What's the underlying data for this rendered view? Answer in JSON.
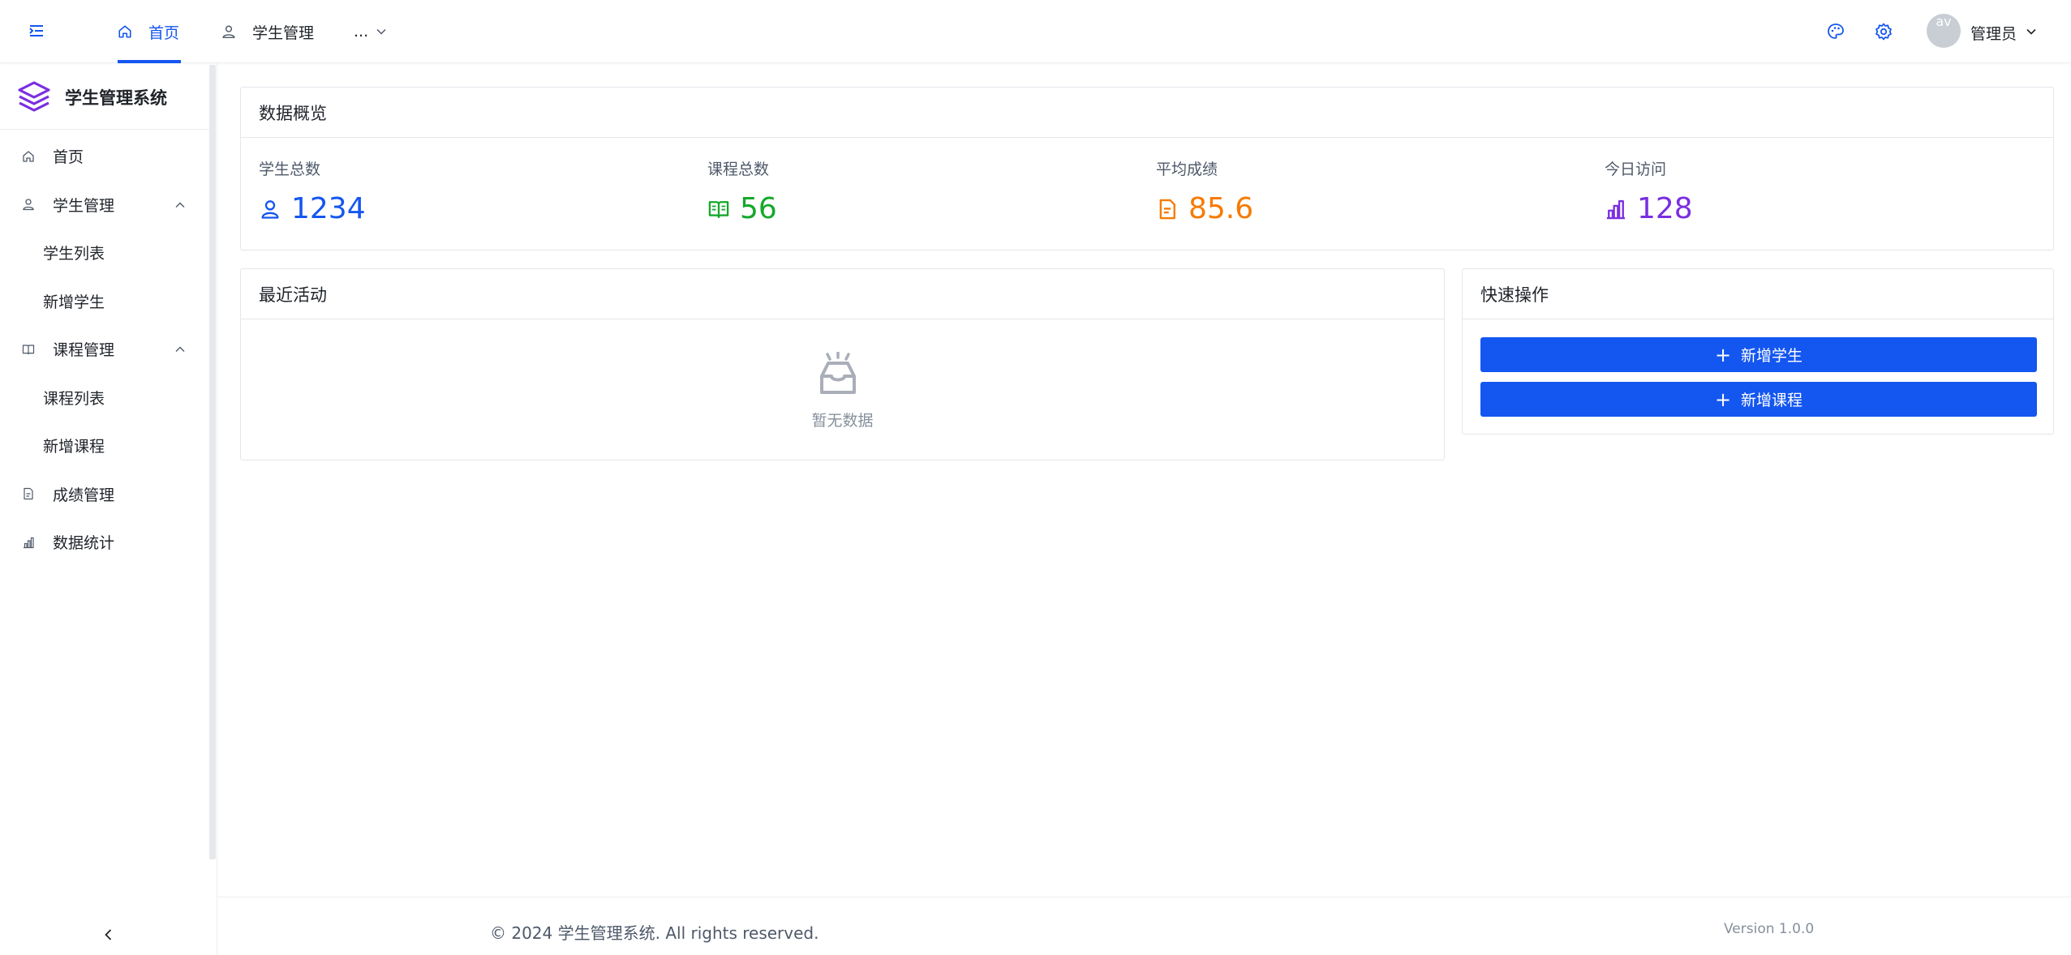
{
  "header": {
    "tabs": [
      {
        "label": "首页",
        "icon": "home-icon",
        "active": true
      },
      {
        "label": "学生管理",
        "icon": "user-icon",
        "active": false
      },
      {
        "label": "...",
        "icon": "chevron-down-icon",
        "active": false
      }
    ],
    "user_name": "管理员",
    "avatar_alt": "av"
  },
  "sidebar": {
    "app_title": "学生管理系统",
    "items": [
      {
        "label": "首页",
        "icon": "home-icon"
      },
      {
        "label": "学生管理",
        "icon": "user-icon",
        "expanded": true,
        "children": [
          {
            "label": "学生列表"
          },
          {
            "label": "新增学生"
          }
        ]
      },
      {
        "label": "课程管理",
        "icon": "book-icon",
        "expanded": true,
        "children": [
          {
            "label": "课程列表"
          },
          {
            "label": "新增课程"
          }
        ]
      },
      {
        "label": "成绩管理",
        "icon": "document-icon"
      },
      {
        "label": "数据统计",
        "icon": "bar-chart-icon"
      }
    ]
  },
  "overview": {
    "title": "数据概览",
    "stats": [
      {
        "label": "学生总数",
        "value": "1234",
        "color": "#1456f0",
        "icon": "user-icon"
      },
      {
        "label": "课程总数",
        "value": "56",
        "color": "#15a82a",
        "icon": "book-icon"
      },
      {
        "label": "平均成绩",
        "value": "85.6",
        "color": "#f77a00",
        "icon": "document-icon"
      },
      {
        "label": "今日访问",
        "value": "128",
        "color": "#7a2ee0",
        "icon": "bar-chart-icon"
      }
    ]
  },
  "recent": {
    "title": "最近活动",
    "empty_text": "暂无数据"
  },
  "quick": {
    "title": "快速操作",
    "actions": [
      {
        "label": "新增学生"
      },
      {
        "label": "新增课程"
      }
    ]
  },
  "footer": {
    "copyright": "© 2024 学生管理系统. All rights reserved.",
    "version": "Version 1.0.0"
  },
  "colors": {
    "primary": "#1456f0",
    "border": "#e5e6eb"
  }
}
